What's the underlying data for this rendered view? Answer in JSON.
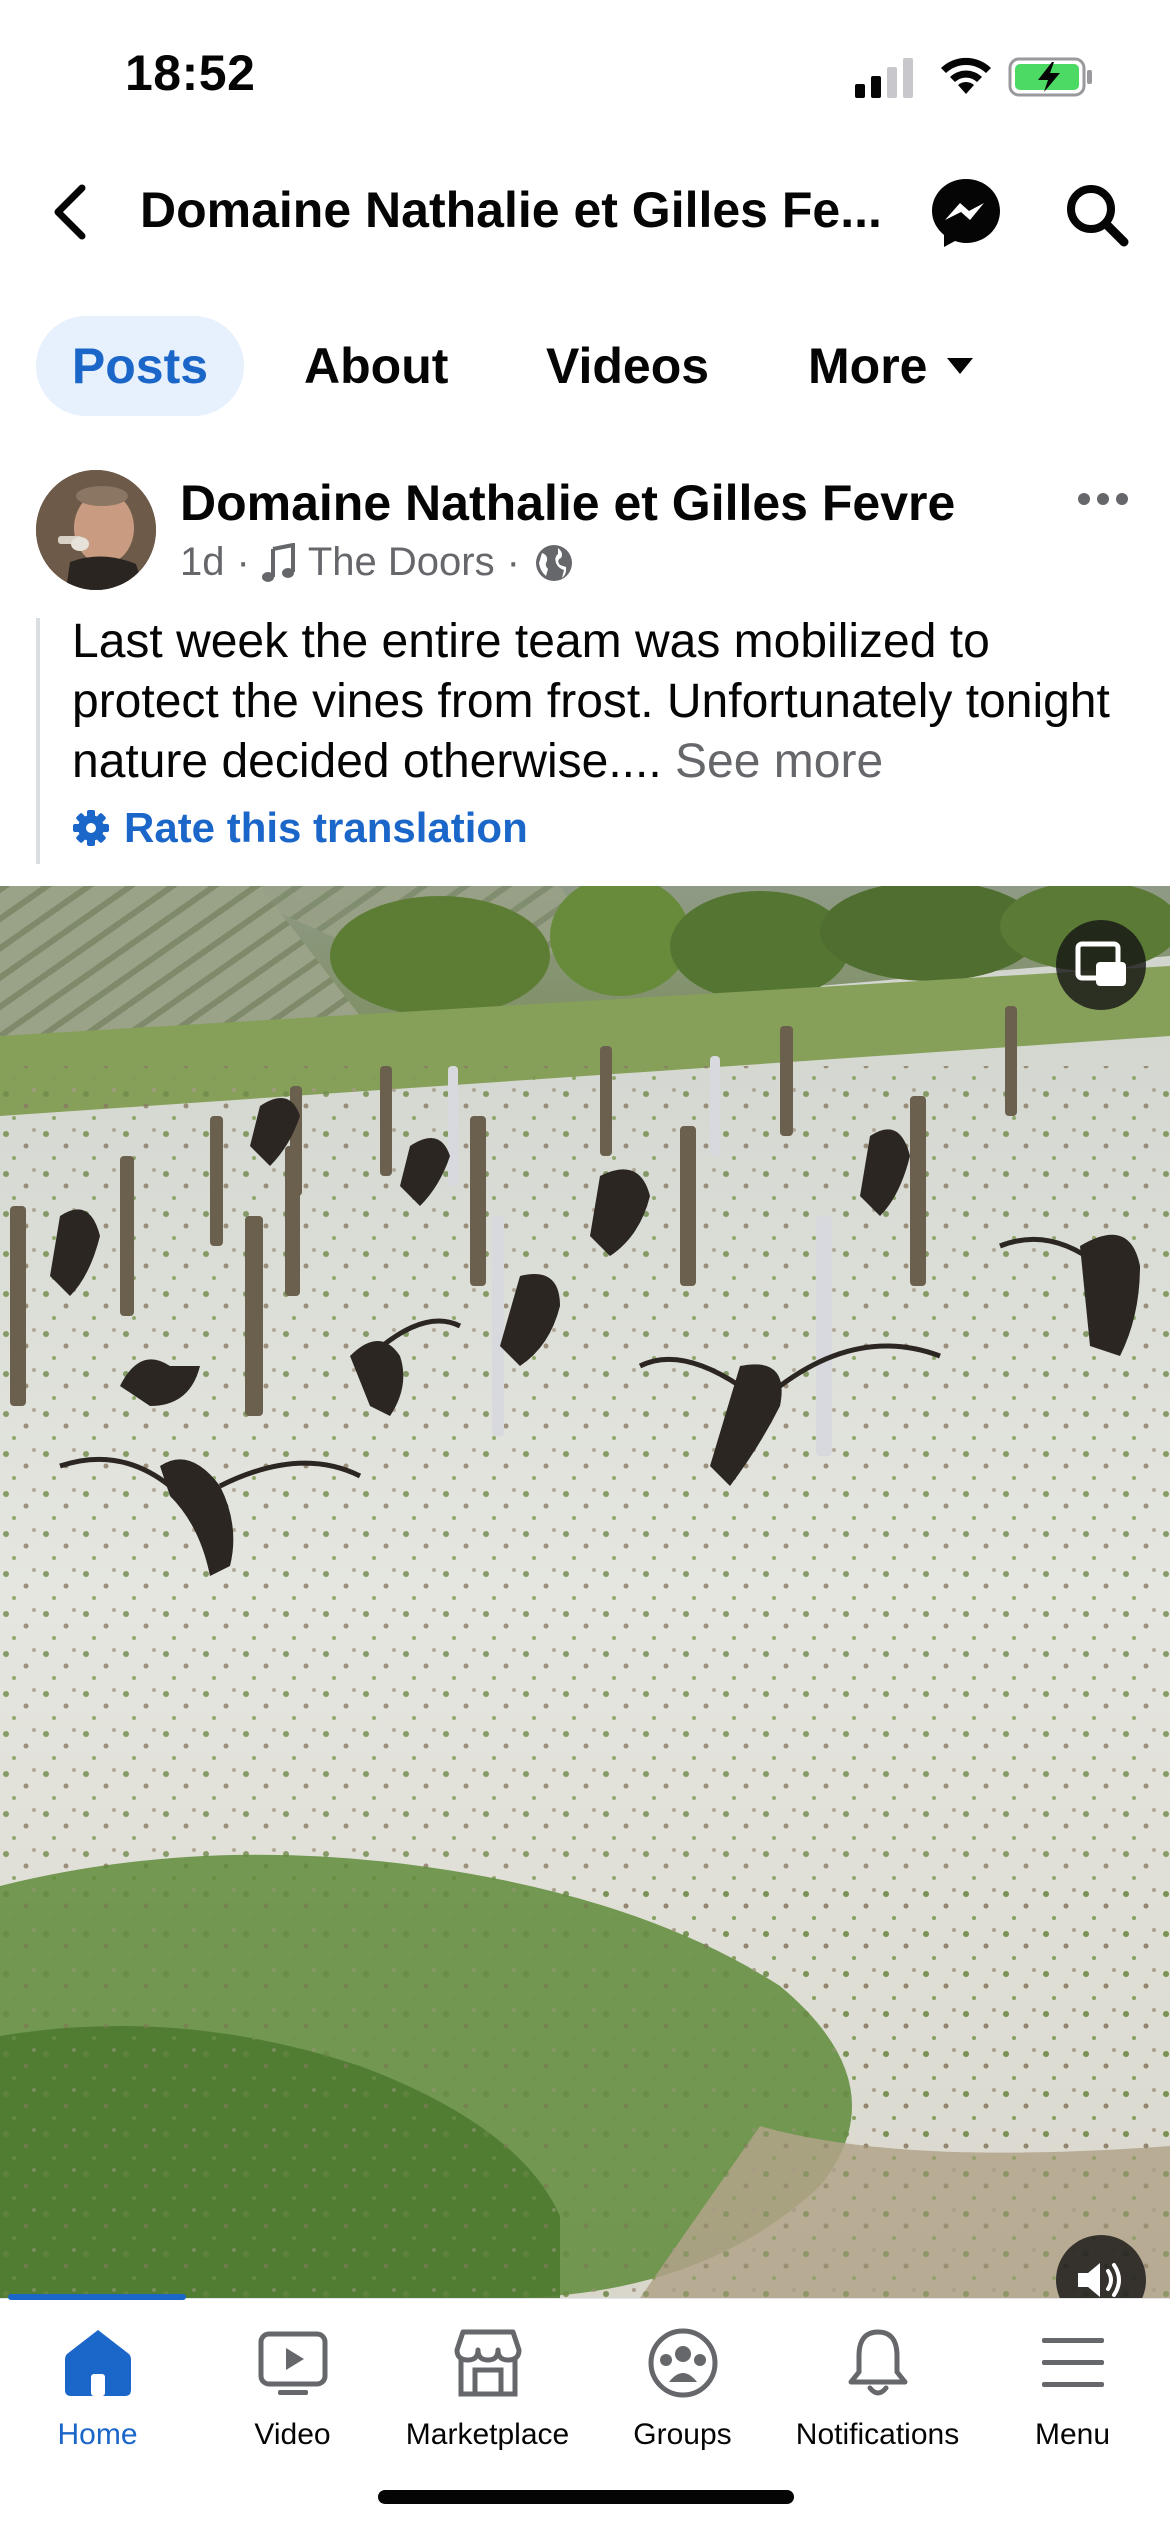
{
  "status_bar": {
    "time": "18:52"
  },
  "header": {
    "title": "Domaine Nathalie et Gilles Fe..."
  },
  "tabs": [
    {
      "label": "Posts"
    },
    {
      "label": "About"
    },
    {
      "label": "Videos"
    },
    {
      "label": "More"
    }
  ],
  "post": {
    "author": "Domaine Nathalie et Gilles Fevre",
    "age": "1d",
    "dot": "·",
    "music": "The Doors",
    "text": "Last week the entire team was mobilized to protect the vines from frost. Unfortunately tonight nature decided otherwise.... ",
    "see_more": "See more",
    "rate_translation": "Rate this translation"
  },
  "bottom_nav": [
    {
      "label": "Home",
      "icon": "home-icon"
    },
    {
      "label": "Video",
      "icon": "video-icon"
    },
    {
      "label": "Marketplace",
      "icon": "marketplace-icon"
    },
    {
      "label": "Groups",
      "icon": "groups-icon"
    },
    {
      "label": "Notifications",
      "icon": "bell-icon"
    },
    {
      "label": "Menu",
      "icon": "menu-icon"
    }
  ],
  "colors": {
    "accent": "#1b66c9",
    "tab_active_bg": "#e7f0fd",
    "muted": "#65676b",
    "battery": "#4cd964"
  }
}
